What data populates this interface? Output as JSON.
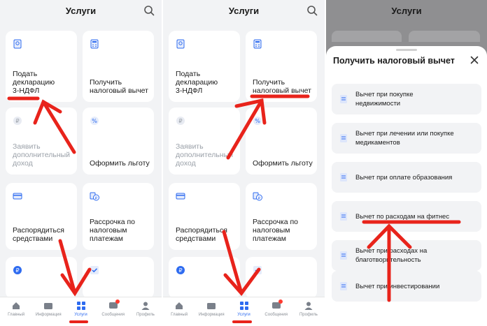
{
  "accent": "#2e6bf0",
  "annotation_color": "#e8231b",
  "panels": [
    {
      "title": "Услуги",
      "cards": [
        {
          "label": "Подать\nдекларацию\n3-НДФЛ",
          "icon": "document-icon",
          "muted": false
        },
        {
          "label": "Получить\nналоговый вычет",
          "icon": "calculator-icon",
          "muted": false
        },
        {
          "label": "Заявить\nдополнительный\nдоход",
          "icon": "ruble-icon",
          "muted": true
        },
        {
          "label": "Оформить льготу",
          "icon": "percent-icon",
          "muted": false
        },
        {
          "label": "Распорядиться\nсредствами",
          "icon": "card-icon",
          "muted": false
        },
        {
          "label": "Рассрочка по\nналоговым\nплатежам",
          "icon": "ruble-coins-icon",
          "muted": false
        }
      ]
    },
    {
      "title": "Услуги"
    }
  ],
  "nav": [
    {
      "label": "Главный",
      "icon": "home-icon",
      "active": false
    },
    {
      "label": "Информация",
      "icon": "info-icon",
      "active": false
    },
    {
      "label": "Услуги",
      "icon": "services-icon",
      "active": true
    },
    {
      "label": "Сообщения",
      "icon": "messages-icon",
      "active": false,
      "badge": true
    },
    {
      "label": "Профиль",
      "icon": "profile-icon",
      "active": false
    }
  ],
  "sheet": {
    "header_title": "Услуги",
    "title": "Получить налоговый вычет",
    "options": [
      {
        "label": "Вычет при покупке\nнедвижимости"
      },
      {
        "label": "Вычет при лечении или покупке\nмедикаментов"
      },
      {
        "label": "Вычет при оплате образования"
      },
      {
        "label": "Вычет по расходам на фитнес"
      },
      {
        "label": "Вычет при расходах на\nблаготворительность"
      },
      {
        "label": "Вычет при инвестировании"
      }
    ]
  }
}
